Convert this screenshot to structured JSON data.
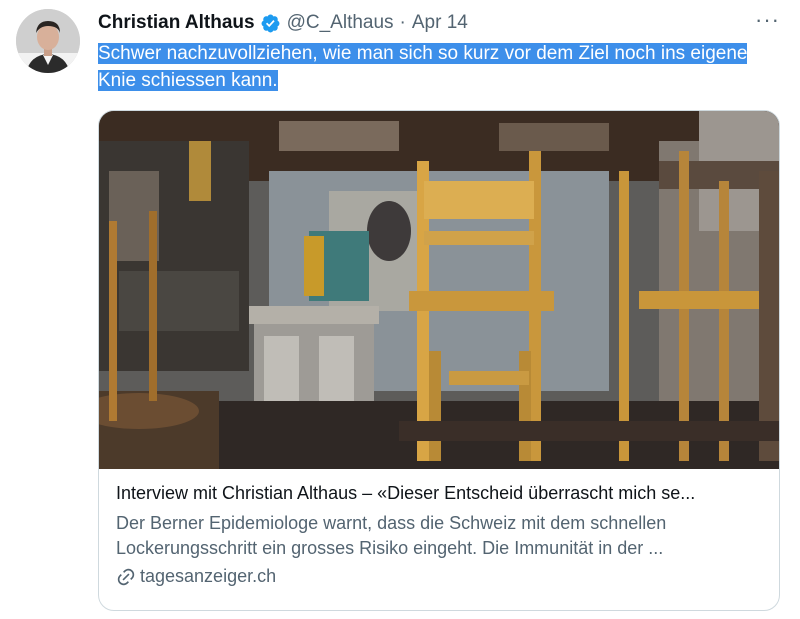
{
  "tweet": {
    "author_name": "Christian Althaus",
    "handle": "@C_Althaus",
    "separator": "·",
    "date": "Apr 14",
    "more_label": "···",
    "text_line1": "Schwer nachzuvollziehen, wie man sich so kurz vor dem Ziel noch ins eigene",
    "text_line2": "Knie schiessen kann."
  },
  "card": {
    "title": "Interview mit Christian Althaus – «Dieser Entscheid überrascht mich se...",
    "description": "Der Berner Epidemiologe warnt, dass die Schweiz mit dem schnellen Lockerungsschritt ein grosses Risiko eingeht. Die Immunität in der ...",
    "domain": "tagesanzeiger.ch"
  },
  "icons": {
    "verified": "verified-badge-icon",
    "link": "link-icon",
    "more": "more-options-icon"
  },
  "colors": {
    "verified_blue": "#1d9bf0",
    "selection_highlight": "#3d8fea",
    "secondary_text": "#536471"
  }
}
